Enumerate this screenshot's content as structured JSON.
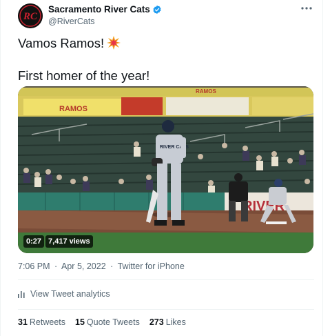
{
  "account": {
    "display_name": "Sacramento River Cats",
    "handle": "@RiverCats",
    "avatar_monogram": "RC",
    "verified": true
  },
  "tweet": {
    "line1": "Vamos Ramos!",
    "line1_emoji": "collision-emoji",
    "line2": "First homer of the year!"
  },
  "video": {
    "duration": "0:27",
    "views": "7,417 views",
    "scene": {
      "banner_text_left": "RAMOS",
      "banner_text_center": "RAMOS",
      "outfield_sign": "RIVER"
    }
  },
  "meta": {
    "time": "7:06 PM",
    "date": "Apr 5, 2022",
    "source": "Twitter for iPhone",
    "separator": "·"
  },
  "analytics": {
    "label": "View Tweet analytics"
  },
  "stats": [
    {
      "count": "31",
      "label": "Retweets"
    },
    {
      "count": "15",
      "label": "Quote Tweets"
    },
    {
      "count": "273",
      "label": "Likes"
    }
  ],
  "colors": {
    "text_primary": "#0f1419",
    "text_secondary": "#536471",
    "verified_blue": "#1d9bf0",
    "avatar_red": "#c8202f"
  }
}
